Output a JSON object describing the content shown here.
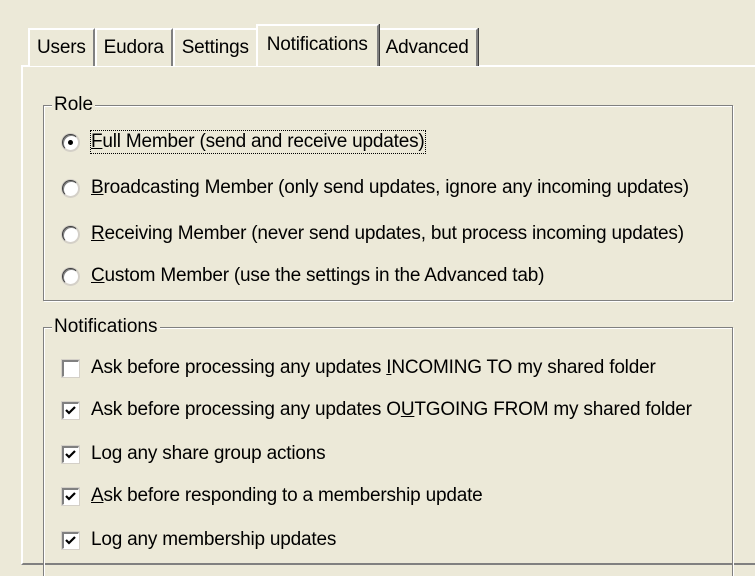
{
  "tabs": [
    {
      "label": "Users",
      "active": false
    },
    {
      "label": "Eudora",
      "active": false
    },
    {
      "label": "Settings",
      "active": false
    },
    {
      "label": "Notifications",
      "active": true
    },
    {
      "label": "Advanced",
      "active": false
    }
  ],
  "role": {
    "legend": "Role",
    "options": [
      {
        "mnemonic": "F",
        "rest": "ull Member (send and receive updates)",
        "selected": true
      },
      {
        "mnemonic": "B",
        "rest": "roadcasting Member (only send updates, ignore any incoming updates)",
        "selected": false
      },
      {
        "mnemonic": "R",
        "rest": "eceiving Member (never send updates, but process incoming updates)",
        "selected": false
      },
      {
        "mnemonic": "C",
        "rest": "ustom Member (use the settings in the Advanced tab)",
        "selected": false
      }
    ]
  },
  "notifications": {
    "legend": "Notifications",
    "items": [
      {
        "pre": "Ask before processing any updates ",
        "mnemonic": "I",
        "post": "NCOMING TO my shared folder",
        "checked": false
      },
      {
        "pre": "Ask before processing any updates O",
        "mnemonic": "U",
        "post": "TGOING FROM my shared folder",
        "checked": true
      },
      {
        "pre": "Log any share group actions",
        "mnemonic": "",
        "post": "",
        "checked": true
      },
      {
        "pre": "",
        "mnemonic": "A",
        "post": "sk before responding to a membership update",
        "checked": true
      },
      {
        "pre": "Log any membership updates",
        "mnemonic": "",
        "post": "",
        "checked": true
      }
    ]
  }
}
